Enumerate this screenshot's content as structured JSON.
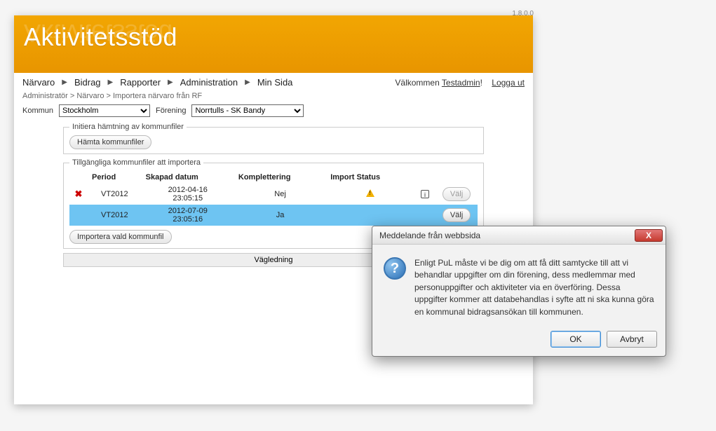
{
  "version": "1.8.0.0",
  "app_title": "Aktivitetsstöd",
  "nav": {
    "items": [
      "Närvaro",
      "Bidrag",
      "Rapporter",
      "Administration",
      "Min Sida"
    ],
    "welcome_prefix": "Välkommen ",
    "username": "Testadmin",
    "welcome_suffix": "!",
    "logout": "Logga ut"
  },
  "breadcrumb": "Administratör > Närvaro > Importera närvaro från RF",
  "filters": {
    "kommun_label": "Kommun",
    "kommun_value": "Stockholm",
    "forening_label": "Förening",
    "forening_value": "Norrtulls - SK Bandy"
  },
  "initiate": {
    "legend": "Initiera hämtning av kommunfiler",
    "button": "Hämta kommunfiler"
  },
  "files": {
    "legend": "Tillgängliga kommunfiler att importera",
    "headers": {
      "period": "Period",
      "created": "Skapad datum",
      "komplettering": "Komplettering",
      "status": "Import Status"
    },
    "rows": [
      {
        "period": "VT2012",
        "created_date": "2012-04-16",
        "created_time": "23:05:15",
        "komplettering": "Nej",
        "has_warning": true,
        "has_help": true,
        "select_label": "Välj",
        "selected": false
      },
      {
        "period": "VT2012",
        "created_date": "2012-07-09",
        "created_time": "23:05:16",
        "komplettering": "Ja",
        "has_warning": false,
        "has_help": false,
        "select_label": "Välj",
        "selected": true
      }
    ],
    "import_button": "Importera vald kommunfil",
    "guidance": "Vägledning"
  },
  "dialog": {
    "title": "Meddelande från webbsida",
    "text": "Enligt PuL måste vi be dig om att få ditt samtycke till att vi behandlar uppgifter om din förening, dess medlemmar med personuppgifter och aktiviteter via en överföring. Dessa uppgifter kommer att databehandlas i syfte att ni ska kunna göra en kommunal bidragsansökan till kommunen.",
    "ok": "OK",
    "cancel": "Avbryt"
  }
}
